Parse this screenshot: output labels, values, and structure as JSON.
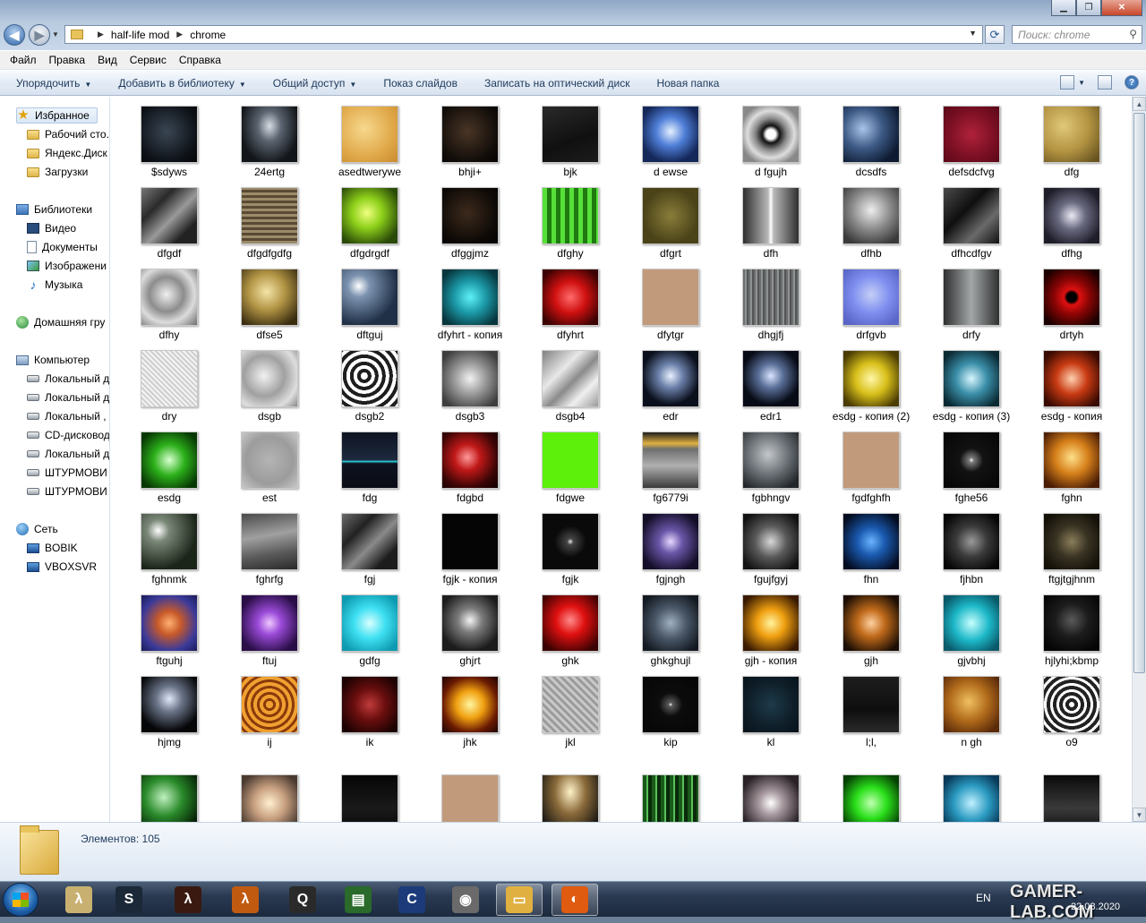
{
  "address": {
    "crumbs": [
      "half-life mod",
      "chrome"
    ],
    "search_placeholder": "Поиск: chrome"
  },
  "menu": [
    "Файл",
    "Правка",
    "Вид",
    "Сервис",
    "Справка"
  ],
  "commands": [
    {
      "label": "Упорядочить",
      "dropdown": true
    },
    {
      "label": "Добавить в библиотеку",
      "dropdown": true
    },
    {
      "label": "Общий доступ",
      "dropdown": true
    },
    {
      "label": "Показ слайдов",
      "dropdown": false
    },
    {
      "label": "Записать на оптический диск",
      "dropdown": false
    },
    {
      "label": "Новая папка",
      "dropdown": false
    }
  ],
  "nav": [
    {
      "label": "Избранное",
      "icon": "star",
      "indent": 0,
      "selected": true
    },
    {
      "label": "Рабочий сто.",
      "icon": "folder",
      "indent": 1
    },
    {
      "label": "Яндекс.Диск",
      "icon": "folder",
      "indent": 1
    },
    {
      "label": "Загрузки",
      "icon": "folder",
      "indent": 1
    },
    {
      "label": "Библиотеки",
      "icon": "lib",
      "indent": 0,
      "gap": true
    },
    {
      "label": "Видео",
      "icon": "video",
      "indent": 1
    },
    {
      "label": "Документы",
      "icon": "doc",
      "indent": 1
    },
    {
      "label": "Изображени",
      "icon": "img",
      "indent": 1
    },
    {
      "label": "Музыка",
      "icon": "music",
      "indent": 1
    },
    {
      "label": "Домашняя гру",
      "icon": "home",
      "indent": 0,
      "gap": true
    },
    {
      "label": "Компьютер",
      "icon": "comp",
      "indent": 0,
      "gap": true
    },
    {
      "label": "Локальный д",
      "icon": "drive",
      "indent": 1
    },
    {
      "label": "Локальный д",
      "icon": "drive",
      "indent": 1
    },
    {
      "label": "Локальный ,",
      "icon": "drive",
      "indent": 1
    },
    {
      "label": "CD-дисковод",
      "icon": "drive",
      "indent": 1
    },
    {
      "label": "Локальный д",
      "icon": "drive",
      "indent": 1
    },
    {
      "label": "ШТУРМОВИ",
      "icon": "drive",
      "indent": 1
    },
    {
      "label": "ШТУРМОВИ",
      "icon": "drive",
      "indent": 1
    },
    {
      "label": "Сеть",
      "icon": "net",
      "indent": 0,
      "gap": true
    },
    {
      "label": "BOBIK",
      "icon": "pc",
      "indent": 1
    },
    {
      "label": "VBOXSVR",
      "icon": "pc",
      "indent": 1
    }
  ],
  "files": [
    {
      "name": "$sdyws",
      "bg": "radial-gradient(circle at 45% 45%,#3a4654,#0e1218 70%,#050607)"
    },
    {
      "name": "24ertg",
      "bg": "radial-gradient(ellipse at 50% 35%,#d8dde4 0%,#5b6470 30%,#121519 75%)"
    },
    {
      "name": "asedtwerywe",
      "bg": "radial-gradient(circle at 40% 40%,#f7d88d,#e0a94a 60%,#c98a2e)"
    },
    {
      "name": "bhji+",
      "bg": "radial-gradient(circle at 45% 45%,#4a3526,#120d09 70%,#050302)"
    },
    {
      "name": "bjk",
      "bg": "linear-gradient(160deg,#2a2a2a,#101010 60%,#1c1c1c)"
    },
    {
      "name": "d ewse",
      "bg": "radial-gradient(circle at 50% 45%,#e6f0ff,#4f7fd8 35%,#15285a 75%)"
    },
    {
      "name": "d fgujh",
      "bg": "radial-gradient(circle at 50% 50%,#fff 0,#fff 12%,#111 22%,#888 40%,#ddd 60%,#888 80%)"
    },
    {
      "name": "dcsdfs",
      "bg": "radial-gradient(circle at 35% 40%,#aac4e8,#3d5a86 40%,#0d1a30 80%)"
    },
    {
      "name": "defsdcfvg",
      "bg": "radial-gradient(circle at 50% 50%,#b0223a,#7a0f23 60%,#5a0818)"
    },
    {
      "name": "dfg",
      "bg": "radial-gradient(circle at 35% 35%,#e0c87a,#b39442 50%,#6a5520 90%)"
    },
    {
      "name": "dfgdf",
      "bg": "linear-gradient(135deg,#777,#2a2a2a 30%,#999 55%,#222 80%)"
    },
    {
      "name": "dfgdfgdfg",
      "bg": "repeating-linear-gradient(0deg,#9b8b6a 0 3px,#5a4a33 3px 6px)"
    },
    {
      "name": "dfgdrgdf",
      "bg": "radial-gradient(circle at 45% 45%,#f0ff80,#8ed11a 35%,#2a4a08 80%)"
    },
    {
      "name": "dfggjmz",
      "bg": "radial-gradient(circle at 45% 45%,#3d2a1c,#0d0906 70%,#040302)"
    },
    {
      "name": "dfghy",
      "bg": "repeating-linear-gradient(90deg,#58e03a 0 5px,#1f7a10 5px 10px)"
    },
    {
      "name": "dfgrt",
      "bg": "radial-gradient(circle,#8a7d3a,#4a4318 70%)"
    },
    {
      "name": "dfh",
      "bg": "linear-gradient(90deg,#2e2e2e,#b8b8b8 45%,#fff 50%,#b8b8b8 55%,#2e2e2e)"
    },
    {
      "name": "dfhb",
      "bg": "radial-gradient(circle at 50% 40%,#eee,#8a8a8a 45%,#3a3a3a 85%)"
    },
    {
      "name": "dfhcdfgv",
      "bg": "linear-gradient(135deg,#4a4a4a,#0e0e0e 40%,#6a6a6a 70%,#111)"
    },
    {
      "name": "dfhg",
      "bg": "radial-gradient(circle at 50% 50%,#eaeaf5,#6a6a80 35%,#1e1e2a 80%)"
    },
    {
      "name": "dfhy",
      "bg": "radial-gradient(circle at 45% 45%,#f0f0f0,#8c8c8c 40%,#dcdcdc 65%,#6d6d6d)"
    },
    {
      "name": "dfse5",
      "bg": "radial-gradient(circle at 45% 40%,#f4e4a8,#b39545 40%,#3a2d10 85%)"
    },
    {
      "name": "dftguj",
      "bg": "radial-gradient(circle at 30% 30%,#fff,#7c93b0 20%,#203047 70%)"
    },
    {
      "name": "dfyhrt - копия",
      "bg": "radial-gradient(circle at 50% 50%,#5ff2f7,#1c9aa8 40%,#07363d 85%)"
    },
    {
      "name": "dfyhrt",
      "bg": "radial-gradient(circle at 50% 50%,#ff6b6b,#d01010 40%,#3d0303 85%)"
    },
    {
      "name": "dfytgr",
      "bg": "#c19a7c"
    },
    {
      "name": "dhgjfj",
      "bg": "repeating-linear-gradient(90deg,#6b6f70 0 2px,#8e9294 2px 4px,#555 4px 6px)"
    },
    {
      "name": "drfgvb",
      "bg": "radial-gradient(circle at 50% 45%,#c4cff6,#7f8ff0 45%,#5a66c8 85%)"
    },
    {
      "name": "drfy",
      "bg": "linear-gradient(90deg,#2e3030,#a4a7a8 50%,#2e3030)"
    },
    {
      "name": "drtyh",
      "bg": "radial-gradient(circle,#000 0,#000 12%,#e01010 20%,#8a0505 45%,#1c0000 85%)"
    },
    {
      "name": "dry",
      "bg": "repeating-linear-gradient(45deg,#f4f4f4 0 2px,#cfcfcf 2px 4px)"
    },
    {
      "name": "dsgb",
      "bg": "radial-gradient(circle at 40% 45%,#f2f2f2,#a0a0a0 45%,#dedede 75%,#888)"
    },
    {
      "name": "dsgb2",
      "bg": "repeating-radial-gradient(circle at 40% 45%,#fff 0 4px,#1e1e1e 4px 8px)"
    },
    {
      "name": "dsgb3",
      "bg": "radial-gradient(circle at 50% 50%,#f2f2f2,#9a9a9a 40%,#3e3e3e 85%)"
    },
    {
      "name": "dsgb4",
      "bg": "linear-gradient(135deg,#808080,#e8e8e8 35%,#8a8a8a 55%,#f0f0f0 75%,#9a9a9a)"
    },
    {
      "name": "edr",
      "bg": "radial-gradient(circle at 50% 45%,#e8f0ff,#6a7fa8 30%,#0a0f1c 70%)"
    },
    {
      "name": "edr1",
      "bg": "radial-gradient(circle at 50% 45%,#d8e4ff,#5a6f98 30%,#070b16 70%)"
    },
    {
      "name": "esdg - копия (2)",
      "bg": "radial-gradient(circle at 50% 50%,#fff7a8,#d8c01a 40%,#4a3c04 85%)"
    },
    {
      "name": "esdg - копия (3)",
      "bg": "radial-gradient(circle at 50% 50%,#d8f6ff,#3a8ea8 40%,#0b2a34 85%)"
    },
    {
      "name": "esdg - копия",
      "bg": "radial-gradient(circle at 50% 50%,#ffd0b0,#c83a12 40%,#380a02 85%)"
    },
    {
      "name": "esdg",
      "bg": "radial-gradient(circle at 50% 50%,#d8ffd0,#2cb01a 40%,#073804 85%)"
    },
    {
      "name": "est",
      "bg": "radial-gradient(circle,#b4b4b4,#9c9c9c 60%,#c8c8c8)"
    },
    {
      "name": "fdg",
      "bg": "linear-gradient(180deg,#0e1220 0,#1e2a40 50%,#2ad4e0 52%,#0e1220 56%,#0b0d16)"
    },
    {
      "name": "fdgbd",
      "bg": "radial-gradient(circle at 45% 45%,#ff9a9a,#c01818 30%,#3a0505 70%,#0e0000)"
    },
    {
      "name": "fdgwe",
      "bg": "#5df00a"
    },
    {
      "name": "fg6779i",
      "bg": "linear-gradient(180deg,#1e1e1e 0,#e0b040 20%,#6e6e6e 30%,#b0b0b0 60%,#3a3a3a)"
    },
    {
      "name": "fgbhngv",
      "bg": "radial-gradient(circle at 45% 40%,#c4c8cc,#6a7075 45%,#22262a 85%)"
    },
    {
      "name": "fgdfghfh",
      "bg": "#c19a7c"
    },
    {
      "name": "fghe56",
      "bg": "radial-gradient(circle at 50% 50%,#fff 0,#7c7c7c 6%,#121212 30%,#050505)"
    },
    {
      "name": "fghn",
      "bg": "radial-gradient(circle at 50% 45%,#ffe08a,#d6801a 40%,#4a1c04 85%)"
    },
    {
      "name": "fghnmk",
      "bg": "radial-gradient(circle at 30% 30%,#fff,#7a8878 20%,#1c251a 70%)"
    },
    {
      "name": "fghrfg",
      "bg": "linear-gradient(170deg,#4a4a4a,#a0a0a0 40%,#5a5a5a 70%,#2a2a2a)"
    },
    {
      "name": "fgj",
      "bg": "linear-gradient(135deg,#6a6a6a,#222 30%,#8a8a8a 55%,#1c1c1c 80%)"
    },
    {
      "name": "fgjk - копия",
      "bg": "#050505"
    },
    {
      "name": "fgjk",
      "bg": "radial-gradient(circle at 50% 50%,#e8e8e8 0,#444 8%,#0a0a0a 40%)"
    },
    {
      "name": "fgjngh",
      "bg": "radial-gradient(ellipse at 50% 50%,#e6d8ff,#6a56a8 30%,#140e28 80%)"
    },
    {
      "name": "fgujfgyj",
      "bg": "radial-gradient(circle at 50% 50%,#d8d8d8,#5a5a5a 40%,#121212 85%)"
    },
    {
      "name": "fhn",
      "bg": "radial-gradient(circle at 50% 50%,#6ab4ff,#1a5ab0 35%,#040c20 85%)"
    },
    {
      "name": "fjhbn",
      "bg": "radial-gradient(circle at 50% 50%,#9a9a9a,#3a3a3a 40%,#060606 85%)"
    },
    {
      "name": "ftgjtgjhnm",
      "bg": "radial-gradient(circle at 50% 50%,#8a7e5a,#3a3424 40%,#141008 85%)"
    },
    {
      "name": "ftguhj",
      "bg": "radial-gradient(circle at 50% 50%,#ffb070,#c85a2a 30%,#3a3a9a 70%,#1a1a5a)"
    },
    {
      "name": "ftuj",
      "bg": "radial-gradient(ellipse at 50% 50%,#f0c8ff,#9a4ad8 30%,#2a0e48 80%)"
    },
    {
      "name": "gdfg",
      "bg": "radial-gradient(circle at 50% 50%,#d8ffff,#3ee0f2 40%,#0e9ab0 85%)"
    },
    {
      "name": "ghjrt",
      "bg": "radial-gradient(circle at 50% 45%,#f4f4f4,#7a7a7a 30%,#1c1c1c 75%)"
    },
    {
      "name": "ghk",
      "bg": "radial-gradient(circle at 50% 45%,#ff8a8a,#e01010 35%,#3a0202 85%)"
    },
    {
      "name": "ghkghujl",
      "bg": "radial-gradient(circle at 50% 50%,#a0b0c0,#4a5868 40%,#141a22 85%)"
    },
    {
      "name": "gjh - копия",
      "bg": "radial-gradient(circle at 50% 50%,#fff3a0,#f0a010 35%,#3a1a02 85%)"
    },
    {
      "name": "gjh",
      "bg": "radial-gradient(circle at 50% 50%,#ffd0a0,#c06a1a 35%,#1c0e04 85%)"
    },
    {
      "name": "gjvbhj",
      "bg": "radial-gradient(circle at 50% 50%,#c8ffff,#1cb8c8 45%,#0a5a6a 85%)"
    },
    {
      "name": "hjlyhi;kbmp",
      "bg": "radial-gradient(circle at 50% 45%,#5a5a5a,#1c1c1c 40%,#050505 85%)"
    },
    {
      "name": "hjmg",
      "bg": "radial-gradient(circle at 50% 40%,#e0e8f8,#6a7488 30%,#050608 75%)"
    },
    {
      "name": "ij",
      "bg": "repeating-radial-gradient(circle at 50% 50%,#f0a030 0 4px,#8a3a0a 4px 7px)"
    },
    {
      "name": "ik",
      "bg": "radial-gradient(circle at 50% 50%,#c03a3a,#6a0e0e 40%,#1c0202 85%)"
    },
    {
      "name": "jhk",
      "bg": "radial-gradient(circle at 50% 50%,#fff6a0,#f0a010 35%,#6a1a02 70%,#1c0400)"
    },
    {
      "name": "jkl",
      "bg": "repeating-linear-gradient(45deg,#c8c8c8 0 3px,#9a9a9a 3px 6px)"
    },
    {
      "name": "kip",
      "bg": "radial-gradient(circle at 50% 50%,#fff 0,#5a5a5a 5%,#0c0c0c 30%,#050505)"
    },
    {
      "name": "kl",
      "bg": "radial-gradient(circle at 50% 50%,#1e3a4a,#0e1e28 60%,#08121a)"
    },
    {
      "name": "l;l,",
      "bg": "linear-gradient(180deg,#1e1e1e,#0e0e0e 60%,#2a2a2a)"
    },
    {
      "name": "n gh",
      "bg": "radial-gradient(circle at 45% 45%,#f0c060,#b06a1a 45%,#5a2a0a 85%)"
    },
    {
      "name": "o9",
      "bg": "repeating-radial-gradient(ellipse at 50% 50%,#fff 0 3px,#222 3px 7px)"
    },
    {
      "name": "",
      "bg": "radial-gradient(circle at 40% 40%,#c0f0c0,#2a8a2a 40%,#041c04 85%)"
    },
    {
      "name": "",
      "bg": "radial-gradient(circle at 50% 50%,#fff0d0,#c8a080 40%,#4a3a30 85%)"
    },
    {
      "name": "",
      "bg": "linear-gradient(180deg,#060606,#1a1a1a 60%,#080808)"
    },
    {
      "name": "",
      "bg": "#c19a7c"
    },
    {
      "name": "",
      "bg": "radial-gradient(ellipse at 50% 30%,#fff2c8,#8a6a3a 40%,#1e1a14 85%)"
    },
    {
      "name": "",
      "bg": "repeating-linear-gradient(90deg,#1a5a1a 0 4px,#5ac05a 4px 6px,#0a2a0a 6px 10px)"
    },
    {
      "name": "",
      "bg": "radial-gradient(circle at 50% 50%,#fff,#a89aa0 30%,#2a2226 80%)"
    },
    {
      "name": "",
      "bg": "radial-gradient(circle at 50% 50%,#c0ffb0,#2ae01a 40%,#064004 85%)"
    },
    {
      "name": "",
      "bg": "radial-gradient(circle at 50% 50%,#c0f0ff,#2a9ac0 45%,#0a3a5a 85%)"
    },
    {
      "name": "",
      "bg": "linear-gradient(180deg,#0a0a0a,#3a3a3a 60%,#101010)"
    }
  ],
  "status": {
    "count_label": "Элементов: 105"
  },
  "taskbar": {
    "apps": [
      {
        "name": "sprite",
        "color": "#c8b070",
        "glyph": "λ"
      },
      {
        "name": "steam",
        "color": "#1b2838",
        "glyph": "S"
      },
      {
        "name": "half-life-mv",
        "color": "#3a1a10",
        "glyph": "λ"
      },
      {
        "name": "half-life",
        "color": "#c05a10",
        "glyph": "λ"
      },
      {
        "name": "quake",
        "color": "#2a2a2a",
        "glyph": "Q"
      },
      {
        "name": "terminal",
        "color": "#2a6a2a",
        "glyph": "▤"
      },
      {
        "name": "cinema4d",
        "color": "#1c3a7a",
        "glyph": "C"
      },
      {
        "name": "reel",
        "color": "#6a6a6a",
        "glyph": "◉"
      },
      {
        "name": "explorer",
        "color": "#e0b040",
        "glyph": "▭"
      },
      {
        "name": "firefox",
        "color": "#e05a10",
        "glyph": "◐"
      }
    ],
    "lang": "EN",
    "date": "22.08.2020",
    "watermark": "GAMER-LAB.COM"
  }
}
